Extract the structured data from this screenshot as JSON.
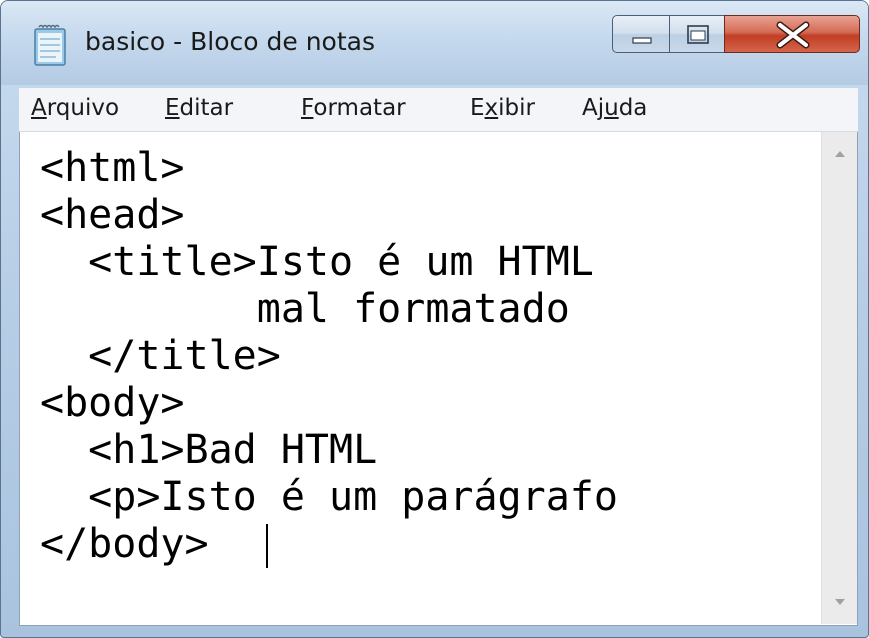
{
  "window": {
    "title": "basico - Bloco de notas"
  },
  "icons": {
    "app": "notepad-icon",
    "minimize": "minimize-icon",
    "maximize": "maximize-icon",
    "close": "close-icon"
  },
  "menu": {
    "items": [
      {
        "label_pre": "",
        "accel": "A",
        "label_post": "rquivo"
      },
      {
        "label_pre": "",
        "accel": "E",
        "label_post": "ditar"
      },
      {
        "label_pre": "",
        "accel": "F",
        "label_post": "ormatar"
      },
      {
        "label_pre": "E",
        "accel": "x",
        "label_post": "ibir"
      },
      {
        "label_pre": "Aj",
        "accel": "u",
        "label_post": "da"
      }
    ]
  },
  "editor": {
    "lines": [
      "<html>",
      "<head>",
      "  <title>Isto é um HTML",
      "         mal formatado",
      "  </title>",
      "<body>",
      "  <h1>Bad HTML",
      "  <p>Isto é um parágrafo",
      "</body>"
    ]
  },
  "colors": {
    "title_bar": "#c7daee",
    "close_button": "#c23e24",
    "editor_background": "#ffffff",
    "text": "#000000"
  }
}
